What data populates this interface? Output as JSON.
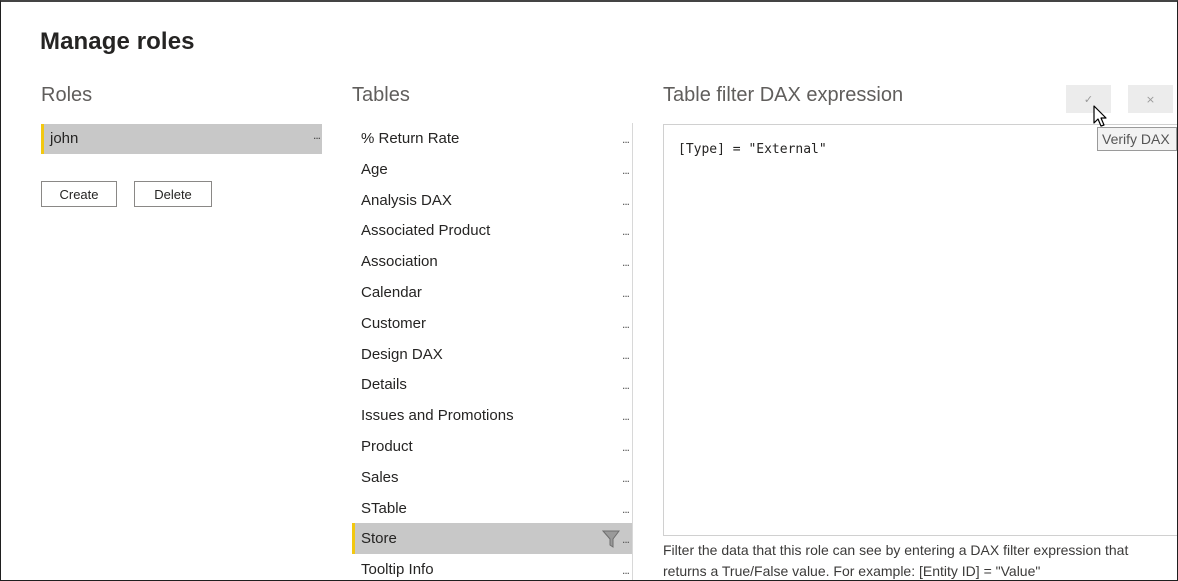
{
  "dialog": {
    "title": "Manage roles"
  },
  "roles": {
    "heading": "Roles",
    "items": [
      {
        "name": "john",
        "more": "..."
      }
    ],
    "create_label": "Create",
    "delete_label": "Delete"
  },
  "tables": {
    "heading": "Tables",
    "more": "...",
    "items": [
      "% Return Rate",
      "Age",
      "Analysis DAX",
      "Associated Product",
      "Association",
      "Calendar",
      "Customer",
      "Design DAX",
      "Details",
      "Issues and Promotions",
      "Product",
      "Sales",
      "STable",
      "Store",
      "Tooltip Info"
    ],
    "selected": "Store"
  },
  "dax": {
    "heading": "Table filter DAX expression",
    "verify_icon": "check-icon",
    "verify_glyph": "✓",
    "cancel_icon": "close-icon",
    "cancel_glyph": "×",
    "expression": "[Type] = \"External\"",
    "tooltip": "Verify DAX",
    "help": "Filter the data that this role can see by entering a DAX filter expression that returns a True/False value. For example: [Entity ID] = \"Value\""
  },
  "colors": {
    "accent": "#f2c811",
    "selected_bg": "#c8c8c8"
  }
}
